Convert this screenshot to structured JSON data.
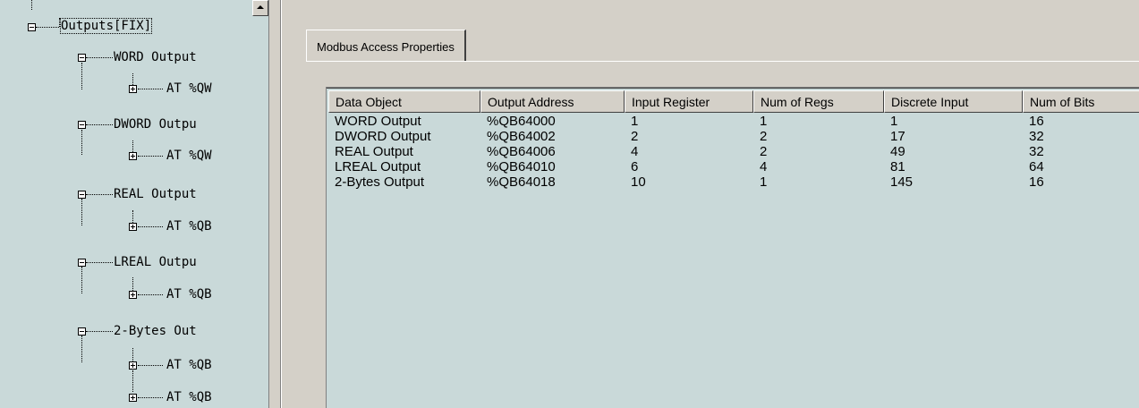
{
  "tree": {
    "items": [
      {
        "label": "Outputs[FIX]",
        "expanded": true
      },
      {
        "label": "WORD Output",
        "expanded": true
      },
      {
        "label": "AT %QW",
        "expanded": false
      },
      {
        "label": "DWORD Outpu",
        "expanded": true
      },
      {
        "label": "AT %QW",
        "expanded": false
      },
      {
        "label": "REAL Output",
        "expanded": true
      },
      {
        "label": "AT %QB",
        "expanded": false
      },
      {
        "label": "LREAL Outpu",
        "expanded": true
      },
      {
        "label": "AT %QB",
        "expanded": false
      },
      {
        "label": "2-Bytes Out",
        "expanded": true
      },
      {
        "label": "AT %QB",
        "expanded": false
      },
      {
        "label": "AT %QB",
        "expanded": false
      }
    ]
  },
  "tab": {
    "label": "Modbus Access Properties"
  },
  "table": {
    "columns": [
      "Data Object",
      "Output Address",
      "Input Register",
      "Num of Regs",
      "Discrete Input",
      "Num of Bits"
    ],
    "rows": [
      [
        "WORD Output",
        "%QB64000",
        "1",
        "1",
        "1",
        "16"
      ],
      [
        "DWORD Output",
        "%QB64002",
        "2",
        "2",
        "17",
        "32"
      ],
      [
        "REAL Output",
        "%QB64006",
        "4",
        "2",
        "49",
        "32"
      ],
      [
        "LREAL Output",
        "%QB64010",
        "6",
        "4",
        "81",
        "64"
      ],
      [
        "2-Bytes Output",
        "%QB64018",
        "10",
        "1",
        "145",
        "16"
      ]
    ]
  },
  "colors": {
    "panel_background": "#c9d9d9",
    "chrome": "#d4d0c8"
  }
}
